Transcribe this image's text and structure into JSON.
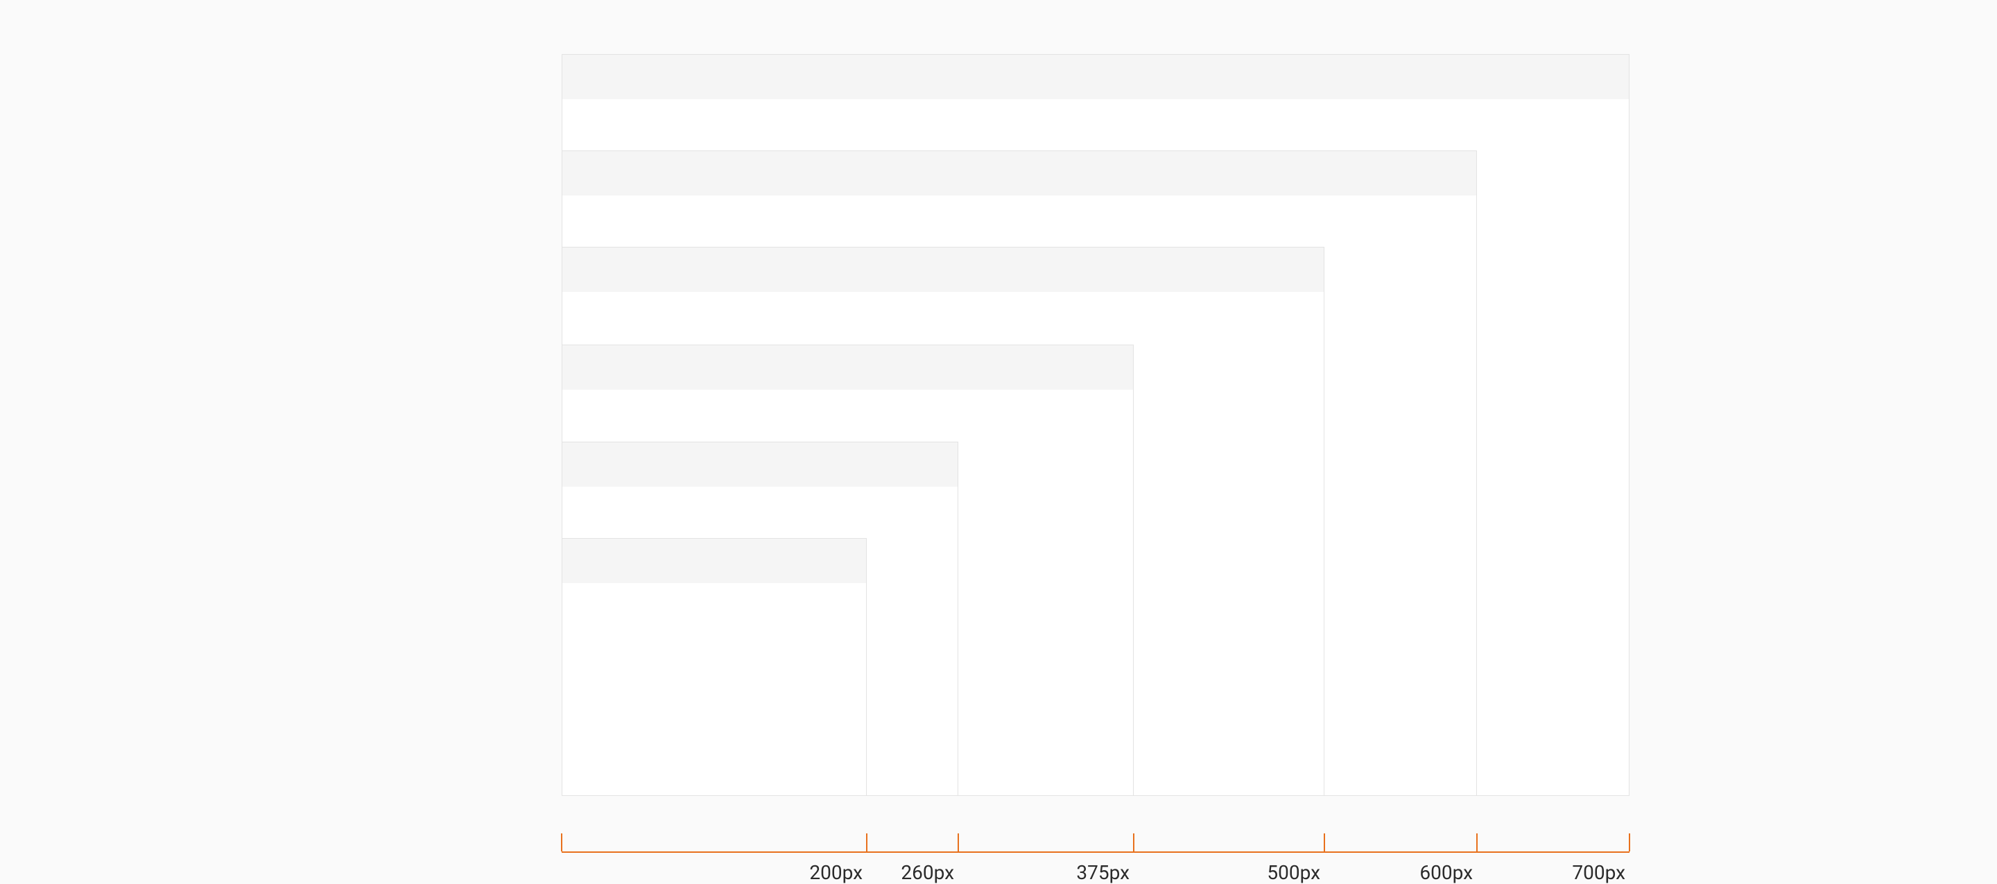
{
  "unit_suffix": "px",
  "axis": {
    "max_value": 700,
    "color": "#e8711d"
  },
  "sizes": [
    {
      "value": 700,
      "height_ratio": 1.0
    },
    {
      "value": 600,
      "height_ratio": 0.87
    },
    {
      "value": 500,
      "height_ratio": 0.74
    },
    {
      "value": 375,
      "height_ratio": 0.608
    },
    {
      "value": 260,
      "height_ratio": 0.478
    },
    {
      "value": 200,
      "height_ratio: ": 0.348,
      "height_ratio": 0.348
    }
  ]
}
